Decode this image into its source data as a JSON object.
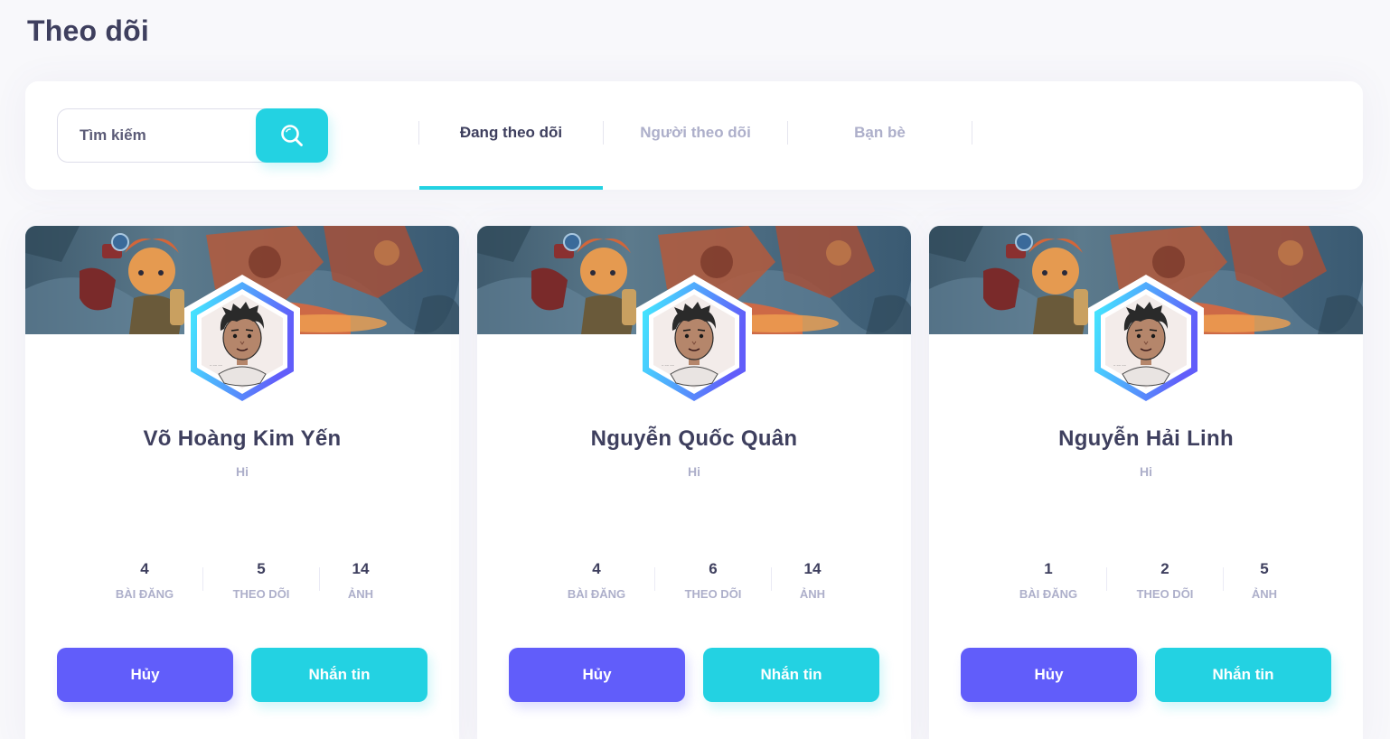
{
  "page": {
    "title": "Theo dõi"
  },
  "search": {
    "placeholder": "Tìm kiếm",
    "value": ""
  },
  "tabs": [
    {
      "label": "Đang theo dõi",
      "active": true
    },
    {
      "label": "Người theo dõi",
      "active": false
    },
    {
      "label": "Bạn bè",
      "active": false
    }
  ],
  "colors": {
    "accent": "#23d2e2",
    "primary": "#615dfa",
    "text": "#3e3f5e",
    "muted": "#adafca"
  },
  "cards": [
    {
      "name": "Võ Hoàng Kim Yến",
      "bio": "Hi",
      "stats": [
        {
          "value": "4",
          "label": "BÀI ĐĂNG"
        },
        {
          "value": "5",
          "label": "THEO DÕI"
        },
        {
          "value": "14",
          "label": "ẢNH"
        }
      ],
      "cancel_label": "Hủy",
      "message_label": "Nhắn tin"
    },
    {
      "name": "Nguyễn Quốc Quân",
      "bio": "Hi",
      "stats": [
        {
          "value": "4",
          "label": "BÀI ĐĂNG"
        },
        {
          "value": "6",
          "label": "THEO DÕI"
        },
        {
          "value": "14",
          "label": "ẢNH"
        }
      ],
      "cancel_label": "Hủy",
      "message_label": "Nhắn tin"
    },
    {
      "name": "Nguyễn Hải Linh",
      "bio": "Hi",
      "stats": [
        {
          "value": "1",
          "label": "BÀI ĐĂNG"
        },
        {
          "value": "2",
          "label": "THEO DÕI"
        },
        {
          "value": "5",
          "label": "ẢNH"
        }
      ],
      "cancel_label": "Hủy",
      "message_label": "Nhắn tin"
    }
  ]
}
